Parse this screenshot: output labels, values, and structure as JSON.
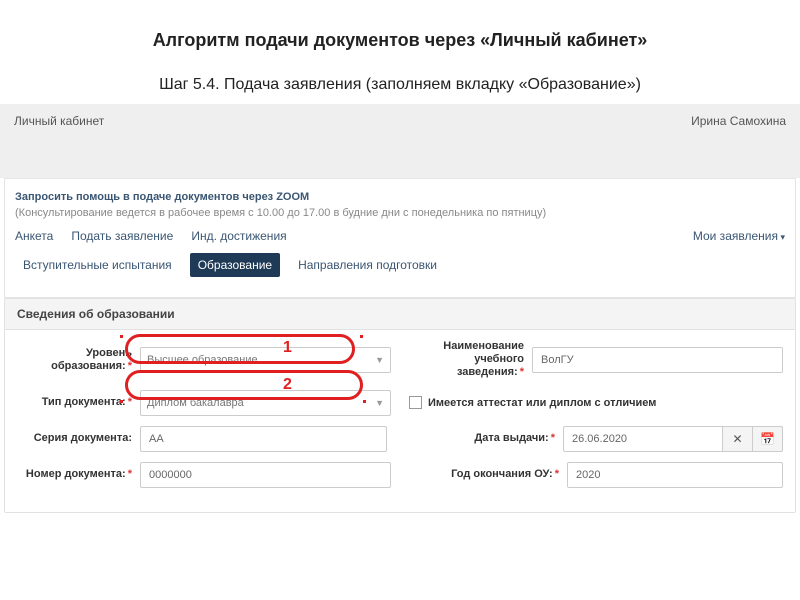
{
  "slide": {
    "title": "Алгоритм подачи документов через «Личный кабинет»",
    "subtitle": "Шаг 5.4. Подача заявления (заполняем вкладку «Образование»)"
  },
  "topbar": {
    "left": "Личный кабинет",
    "right": "Ирина Самохина"
  },
  "help": {
    "link": "Запросить помощь в подаче документов через ZOOM",
    "note": "(Консультирование ведется в рабочее время с 10.00 до 17.00 в будние дни с понедельника по пятницу)"
  },
  "tabs1": {
    "anketa": "Анкета",
    "podat": "Подать заявление",
    "ind": "Инд. достижения",
    "my": "Мои заявления"
  },
  "tabs2": {
    "exams": "Вступительные испытания",
    "edu": "Образование",
    "dirs": "Направления подготовки"
  },
  "section_title": "Сведения об образовании",
  "labels": {
    "level": "Уровень образования:",
    "doctype": "Тип документа:",
    "series": "Серия документа:",
    "number": "Номер документа:",
    "school": "Наименование учебного заведения:",
    "honors": "Имеется аттестат или диплом с отличием",
    "date": "Дата выдачи:",
    "year": "Год окончания ОУ:"
  },
  "values": {
    "level": "Высшее образование",
    "doctype": "Диплом бакалавра",
    "series": "АА",
    "number": "0000000",
    "school": "ВолГУ",
    "date": "26.06.2020",
    "year": "2020"
  },
  "annotations": {
    "n1": "1",
    "n2": "2"
  }
}
